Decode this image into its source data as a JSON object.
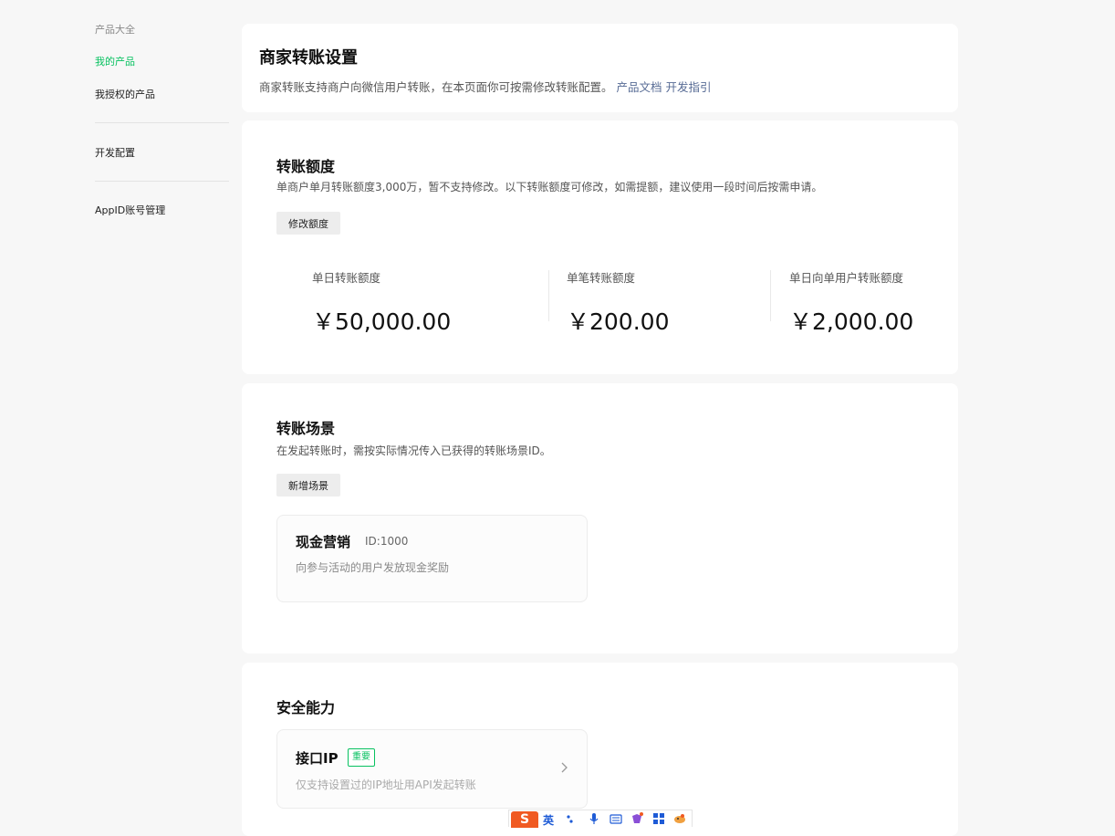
{
  "sidebar": {
    "section_title": "产品大全",
    "items": [
      {
        "label": "我的产品"
      },
      {
        "label": "我授权的产品"
      },
      {
        "label": "开发配置"
      },
      {
        "label": "AppID账号管理"
      }
    ]
  },
  "header": {
    "title": "商家转账设置",
    "description": "商家转账支持商户向微信用户转账，在本页面你可按需修改转账配置。",
    "links": [
      "产品文档",
      "开发指引"
    ]
  },
  "limits": {
    "title": "转账额度",
    "description": "单商户单月转账额度3,000万，暂不支持修改。以下转账额度可修改，如需提额，建议使用一段时间后按需申请。",
    "button_label": "修改额度",
    "items": [
      {
        "label": "单日转账额度",
        "value": "￥50,000.00"
      },
      {
        "label": "单笔转账额度",
        "value": "￥200.00"
      },
      {
        "label": "单日向单用户转账额度",
        "value": "￥2,000.00"
      }
    ]
  },
  "scenes": {
    "title": "转账场景",
    "description": "在发起转账时，需按实际情况传入已获得的转账场景ID。",
    "button_label": "新增场景",
    "items": [
      {
        "name": "现金营销",
        "id": "ID:1000",
        "description": "向参与活动的用户发放现金奖励"
      }
    ]
  },
  "security": {
    "title": "安全能力",
    "items": [
      {
        "name": "接口IP",
        "badge": "重要",
        "description": "仅支持设置过的IP地址用API发起转账"
      }
    ]
  },
  "ime": {
    "logo": "S",
    "mode": "英"
  },
  "colors": {
    "accent": "#07c160",
    "link": "#576b95",
    "background": "#f7f7f7",
    "ime": "#f05a22"
  }
}
